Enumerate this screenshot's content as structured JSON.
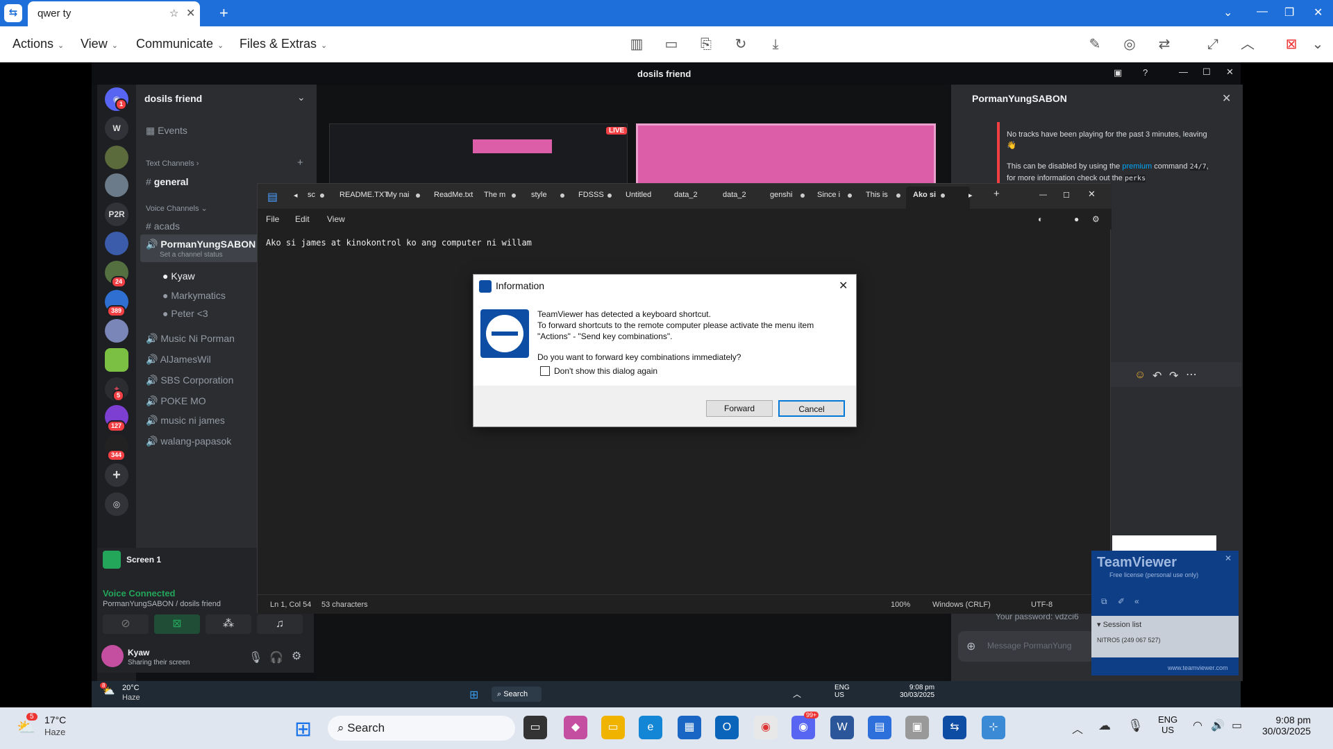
{
  "tv_tab": {
    "title": "qwer ty"
  },
  "tv_menu": [
    "Actions",
    "View",
    "Communicate",
    "Files & Extras"
  ],
  "remote_title": "dosils friend",
  "discord": {
    "server_name": "dosils friend",
    "events": "Events",
    "text_channels_header": "Text Channels",
    "general": "general",
    "voice_channels_header": "Voice Channels",
    "acads": "acads",
    "active_voice": "PormanYungSABON",
    "channel_status": "Set a channel status",
    "members": [
      "Kyaw",
      "Markymatics",
      "Peter <3"
    ],
    "voice_channels": [
      "Music Ni Porman",
      "AlJamesWil",
      "SBS Corporation",
      "POKE MO",
      "music ni james",
      "walang-papasok"
    ],
    "server_letters": [
      "W",
      "P2R"
    ],
    "badges": [
      "1",
      "24",
      "389",
      "5",
      "127",
      "344"
    ],
    "screen_label": "Screen 1",
    "voice_connected": "Voice Connected",
    "voice_path": "PormanYungSABON / dosils friend",
    "user_name": "Kyaw",
    "user_status": "Sharing their screen",
    "live": "LIVE",
    "right_title": "PormanYungSABON",
    "bot_msg1": "No tracks have been playing for the past 3 minutes, leaving 👋",
    "bot_msg2a": "This can be disabled by using the",
    "bot_msg2b": "premium",
    "bot_msg2c": "command",
    "bot_msg3a": "24/7",
    "bot_msg3b": ", for more information check out the",
    "bot_msg3c": "perks",
    "password": "Your password: vdzci6",
    "message_placeholder": "Message PormanYung"
  },
  "notepad": {
    "tabs": [
      "sc",
      "README.TXT",
      "My nai",
      "ReadMe.txt",
      "The m",
      "style",
      "FDSSS",
      "Untitled",
      "data_2",
      "data_2",
      "genshi",
      "Since i",
      "This is",
      "Ako si"
    ],
    "menu": [
      "File",
      "Edit",
      "View"
    ],
    "text": "Ako si james at kinokontrol ko ang computer ni willam",
    "status_pos": "Ln 1, Col 54",
    "status_chars": "53 characters",
    "zoom": "100%",
    "eol": "Windows (CRLF)",
    "enc": "UTF-8"
  },
  "dialog": {
    "title": "Information",
    "line1": "TeamViewer has detected a keyboard shortcut.",
    "line2": "To forward shortcuts to the remote computer please activate the menu item",
    "line3": "\"Actions\" - \"Send key combinations\".",
    "question": "Do you want to forward key combinations immediately?",
    "checkbox": "Don't show this dialog again",
    "forward": "Forward",
    "cancel": "Cancel"
  },
  "tv_mini": {
    "brand": "TeamViewer",
    "license": "Free license (personal use only)",
    "session_list": "Session list",
    "session": "NITRO5 (249 067 527)",
    "url": "www.teamviewer.com"
  },
  "remote_taskbar": {
    "temp": "20°C",
    "weather": "Haze",
    "search": "Search",
    "lang1": "ENG",
    "lang2": "US",
    "time": "9:08 pm",
    "date": "30/03/2025",
    "badge": "8"
  },
  "taskbar": {
    "temp": "17°C",
    "weather": "Haze",
    "search": "Search",
    "lang1": "ENG",
    "lang2": "US",
    "time": "9:08 pm",
    "date": "30/03/2025",
    "badge": "5",
    "discord_badge": "99+"
  }
}
